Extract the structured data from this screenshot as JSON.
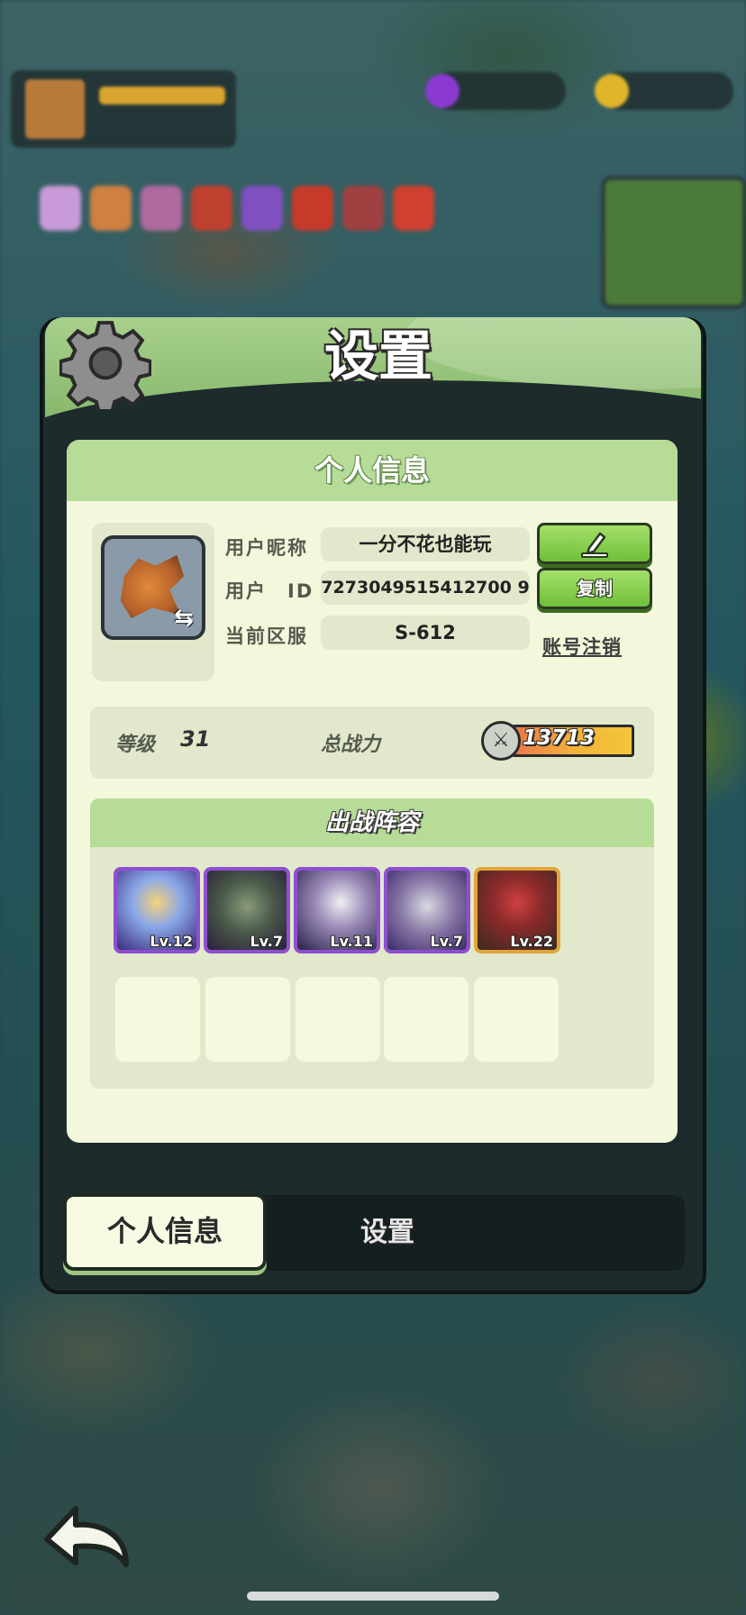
{
  "panel": {
    "title": "设置",
    "section_title": "个人信息"
  },
  "profile": {
    "nickname_label": "用户昵称",
    "nickname_value": "一分不花也能玩",
    "id_label": "用户　ID",
    "id_value": "7273049515412700 9",
    "server_label": "当前区服",
    "server_value": "S-612",
    "copy_label": "复制",
    "logout_label": "账号注销",
    "edit_icon": "pencil-icon",
    "swap_icon": "swap-icon"
  },
  "stats": {
    "level_label": "等级",
    "level_value": "31",
    "power_label": "总战力",
    "power_value": "13713"
  },
  "lineup": {
    "title": "出战阵容",
    "heroes": [
      {
        "level": "Lv.12",
        "rarity": "purple"
      },
      {
        "level": "Lv.7",
        "rarity": "purple"
      },
      {
        "level": "Lv.11",
        "rarity": "purple"
      },
      {
        "level": "Lv.7",
        "rarity": "purple"
      },
      {
        "level": "Lv.22",
        "rarity": "gold"
      }
    ]
  },
  "tabs": {
    "profile": "个人信息",
    "settings": "设置"
  },
  "colors": {
    "header_green": "#a8d18c",
    "card_bg": "#f3f8dc",
    "button_green": "#6fbf3a",
    "purple_frame": "#8f4fd0",
    "gold_frame": "#e0a63a"
  }
}
